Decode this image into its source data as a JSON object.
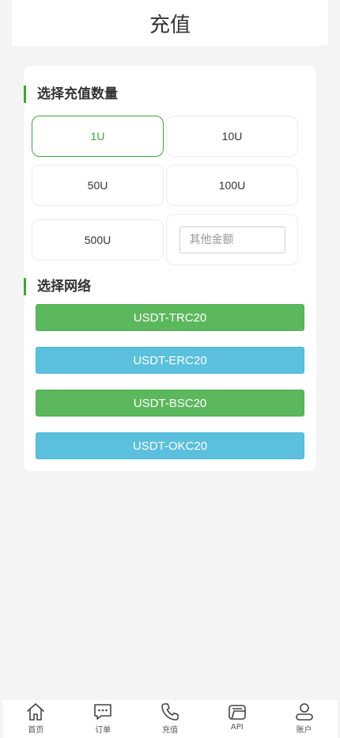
{
  "header": {
    "title": "充值"
  },
  "amount_section": {
    "title": "选择充值数量",
    "options": [
      "1U",
      "10U",
      "50U",
      "100U",
      "500U"
    ],
    "selected": "1U",
    "other_placeholder": "其他金额"
  },
  "network_section": {
    "title": "选择网络",
    "networks": [
      {
        "label": "USDT-TRC20",
        "color": "#5cb85c"
      },
      {
        "label": "USDT-ERC20",
        "color": "#5bc0de"
      },
      {
        "label": "USDT-BSC20",
        "color": "#5cb85c"
      },
      {
        "label": "USDT-OKC20",
        "color": "#5bc0de"
      }
    ]
  },
  "tabbar": {
    "items": [
      {
        "label": "首页",
        "icon": "home-icon"
      },
      {
        "label": "订单",
        "icon": "chat-icon"
      },
      {
        "label": "充值",
        "icon": "phone-icon"
      },
      {
        "label": "API",
        "icon": "folder-icon"
      },
      {
        "label": "账户",
        "icon": "user-icon"
      }
    ]
  },
  "colors": {
    "accent": "#3aa935",
    "green_button": "#5cb85c",
    "blue_button": "#5bc0de"
  }
}
